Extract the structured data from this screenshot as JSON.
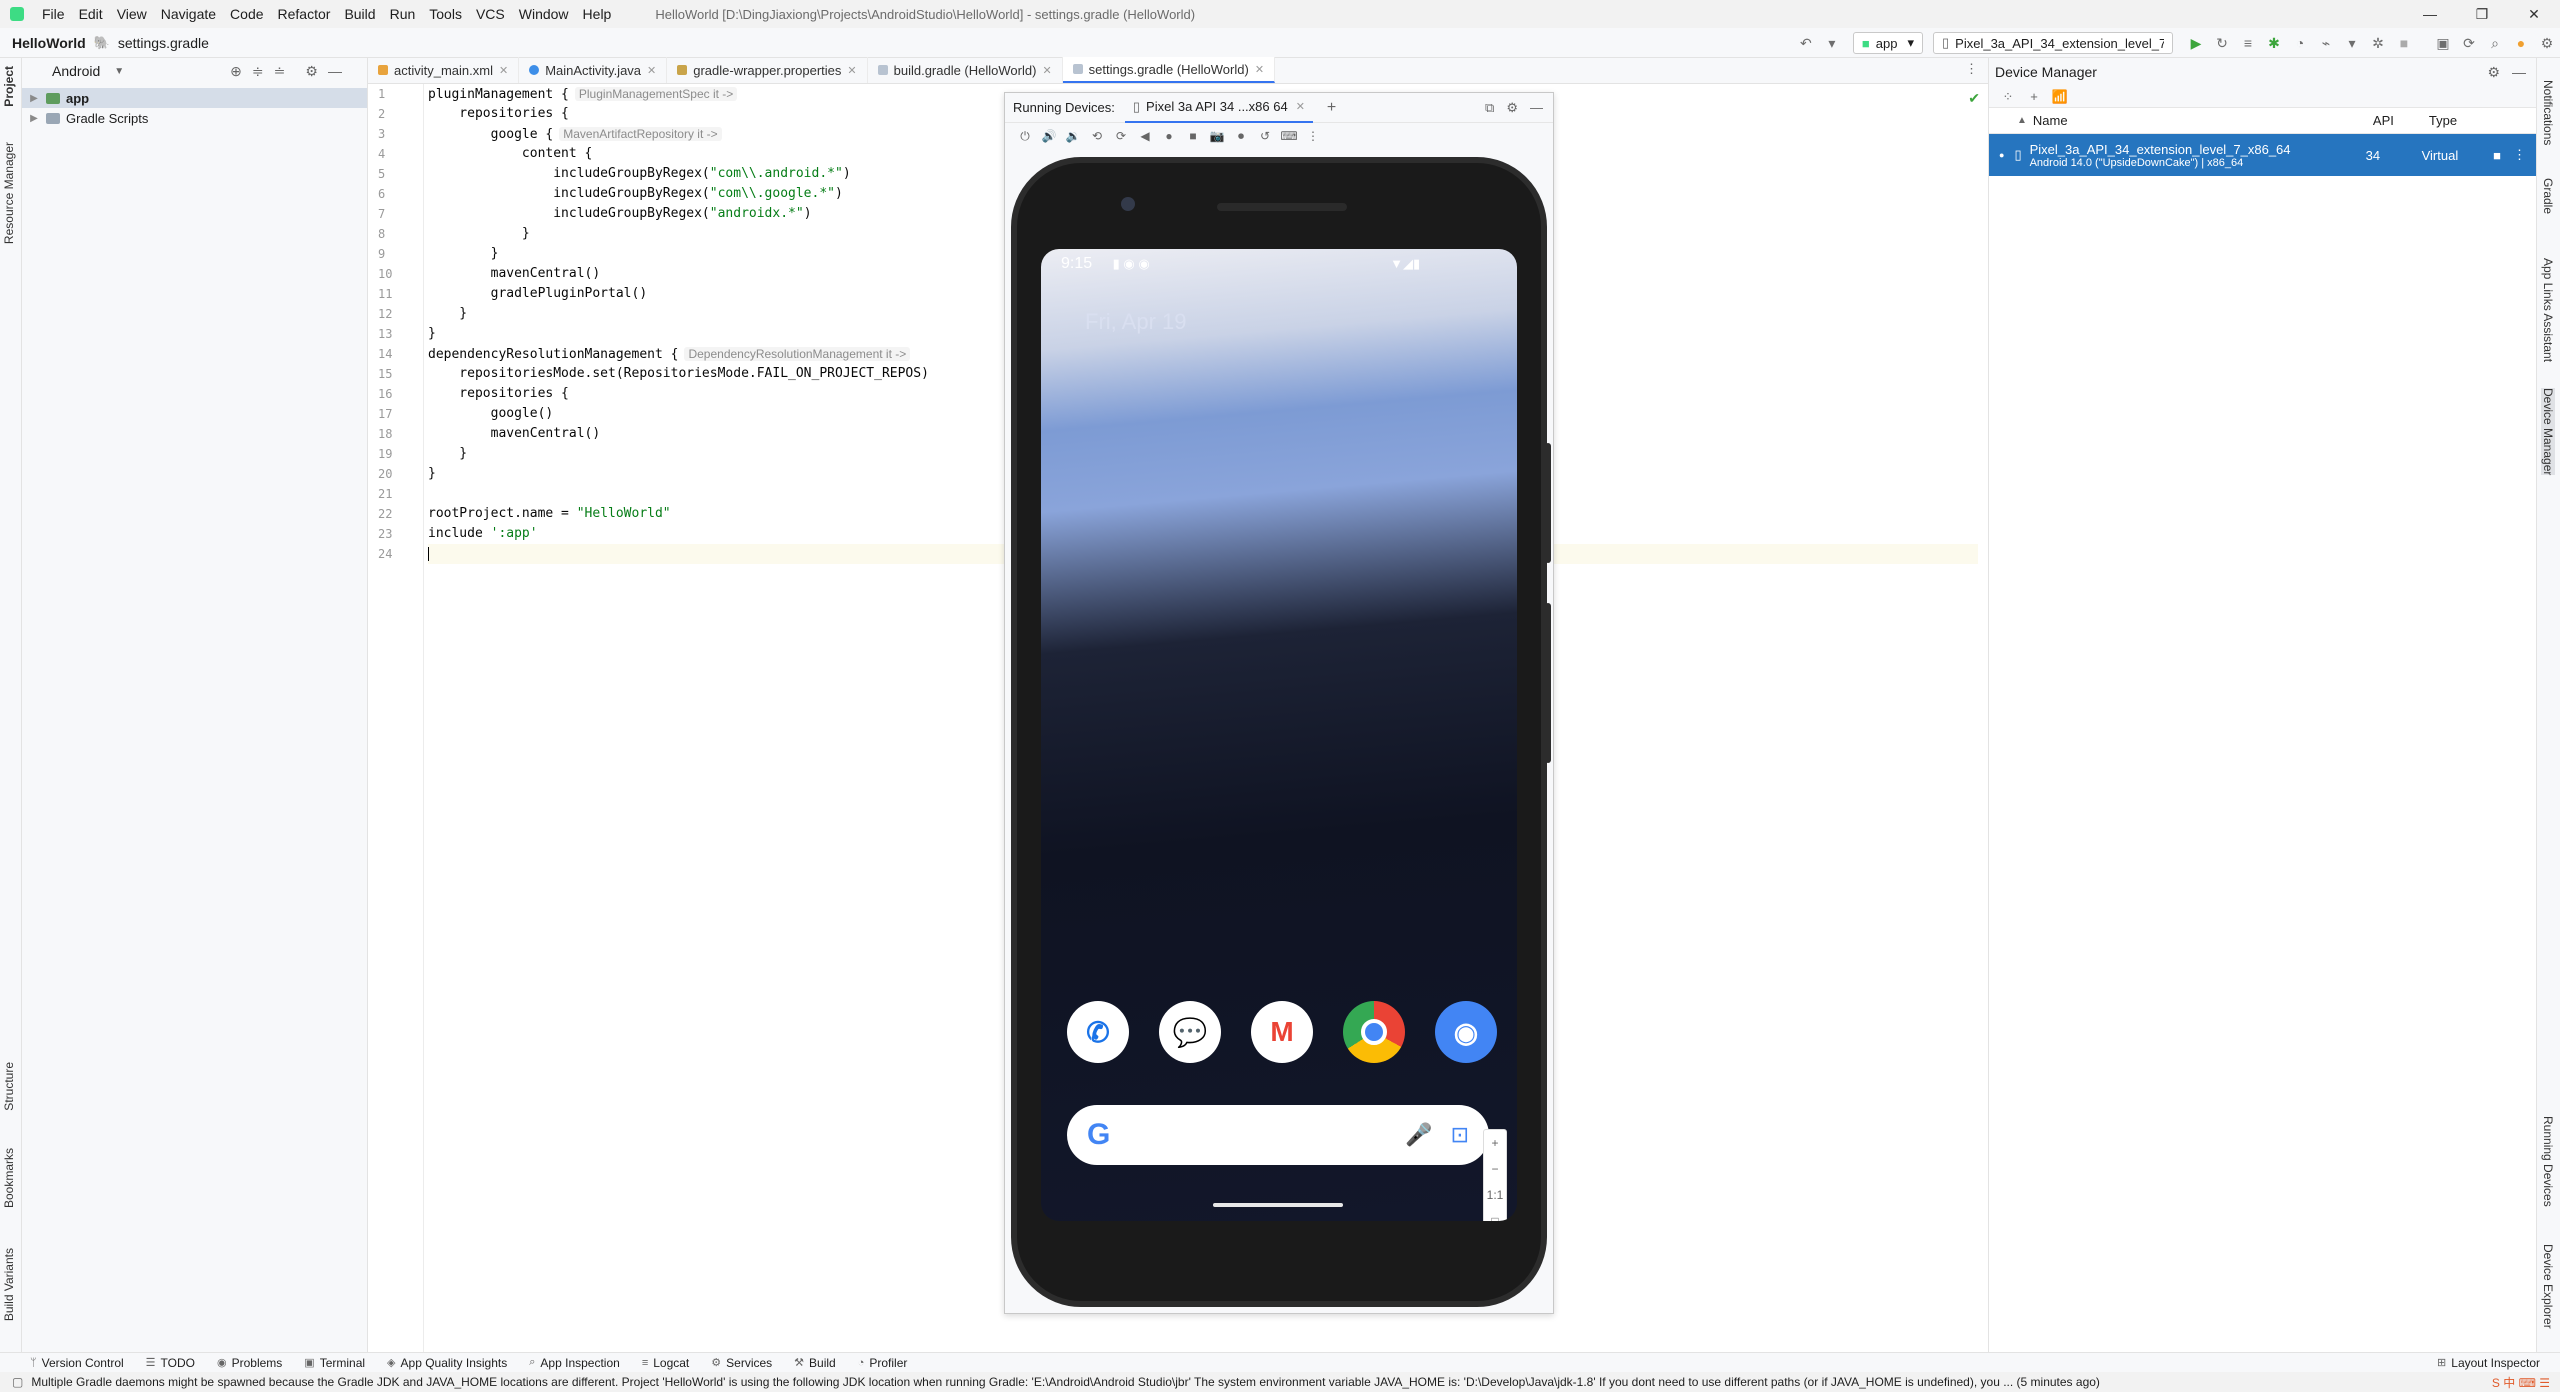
{
  "menubar": {
    "items": [
      "File",
      "Edit",
      "View",
      "Navigate",
      "Code",
      "Refactor",
      "Build",
      "Run",
      "Tools",
      "VCS",
      "Window",
      "Help"
    ],
    "window_title": "HelloWorld [D:\\DingJiaxiong\\Projects\\AndroidStudio\\HelloWorld] - settings.gradle (HelloWorld)"
  },
  "navbar": {
    "project": "HelloWorld",
    "file": "settings.gradle",
    "run_config": "app",
    "device": "Pixel_3a_API_34_extension_level_7_x8..."
  },
  "project_panel": {
    "view_mode": "Android",
    "items": [
      {
        "label": "app",
        "selected": true
      },
      {
        "label": "Gradle Scripts",
        "selected": false
      }
    ]
  },
  "left_stripe": {
    "labels": [
      "Project",
      "Resource Manager",
      "Structure",
      "Bookmarks",
      "Build Variants"
    ]
  },
  "editor": {
    "tabs": [
      {
        "label": "activity_main.xml",
        "active": false
      },
      {
        "label": "MainActivity.java",
        "active": false
      },
      {
        "label": "gradle-wrapper.properties",
        "active": false
      },
      {
        "label": "build.gradle (HelloWorld)",
        "active": false
      },
      {
        "label": "settings.gradle (HelloWorld)",
        "active": true
      }
    ],
    "line_numbers": [
      "1",
      "2",
      "3",
      "4",
      "5",
      "6",
      "7",
      "8",
      "9",
      "10",
      "11",
      "12",
      "13",
      "14",
      "15",
      "16",
      "17",
      "18",
      "19",
      "20",
      "21",
      "22",
      "23",
      "24"
    ],
    "lines": [
      {
        "pre": "pluginManagement {",
        "hint": "PluginManagementSpec it ->"
      },
      {
        "pre": "    repositories {"
      },
      {
        "pre": "        google {",
        "hint": "MavenArtifactRepository it ->"
      },
      {
        "pre": "            content {"
      },
      {
        "pre": "                includeGroupByRegex(",
        "str": "\"com\\\\.android.*\"",
        "post": ")"
      },
      {
        "pre": "                includeGroupByRegex(",
        "str": "\"com\\\\.google.*\"",
        "post": ")"
      },
      {
        "pre": "                includeGroupByRegex(",
        "str": "\"androidx.*\"",
        "post": ")"
      },
      {
        "pre": "            }"
      },
      {
        "pre": "        }"
      },
      {
        "pre": "        mavenCentral()"
      },
      {
        "pre": "        gradlePluginPortal()"
      },
      {
        "pre": "    }"
      },
      {
        "pre": "}"
      },
      {
        "pre": "dependencyResolutionManagement {",
        "hint": "DependencyResolutionManagement it ->"
      },
      {
        "pre": "    repositoriesMode.set(RepositoriesMode.FAIL_ON_PROJECT_REPOS)"
      },
      {
        "pre": "    repositories {"
      },
      {
        "pre": "        google()"
      },
      {
        "pre": "        mavenCentral()"
      },
      {
        "pre": "    }"
      },
      {
        "pre": "}"
      },
      {
        "pre": ""
      },
      {
        "pre": "rootProject.name = ",
        "str": "\"HelloWorld\""
      },
      {
        "pre": "include ",
        "str": "':app'"
      },
      {
        "pre": "",
        "current": true
      }
    ]
  },
  "running_devices": {
    "title": "Running Devices:",
    "tab": "Pixel 3a API 34 ...x86 64",
    "phone": {
      "time": "9:15",
      "date": "Fri, Apr 19",
      "dock_apps": [
        "phone-app",
        "messages-app",
        "gmail-app",
        "chrome-app",
        "camera-app"
      ],
      "zoom_controls": [
        "+",
        "−",
        "1:1",
        "□"
      ]
    }
  },
  "device_manager": {
    "title": "Device Manager",
    "columns": [
      "Name",
      "API",
      "Type"
    ],
    "devices": [
      {
        "name": "Pixel_3a_API_34_extension_level_7_x86_64",
        "subtitle": "Android 14.0 (\"UpsideDownCake\") | x86_64",
        "api": "34",
        "type": "Virtual"
      }
    ]
  },
  "right_stripe": {
    "labels": [
      "Notifications",
      "Gradle",
      "App Links Assistant",
      "Device Manager",
      "Running Devices",
      "Device Explorer"
    ]
  },
  "bottom_tools": [
    "Version Control",
    "TODO",
    "Problems",
    "Terminal",
    "App Quality Insights",
    "App Inspection",
    "Logcat",
    "Services",
    "Build",
    "Profiler"
  ],
  "layout_inspector": "Layout Inspector",
  "status_message": "Multiple Gradle daemons might be spawned because the Gradle JDK and JAVA_HOME locations are different. Project 'HelloWorld' is using the following JDK location when running Gradle: 'E:\\Android\\Android Studio\\jbr' The system environment variable JAVA_HOME is: 'D:\\Develop\\Java\\jdk-1.8' If you dont need to use different paths (or if JAVA_HOME is undefined), you ... (5 minutes ago)",
  "colors": {
    "accent": "#3574f0",
    "selection": "#2675bf",
    "string": "#067d17"
  }
}
